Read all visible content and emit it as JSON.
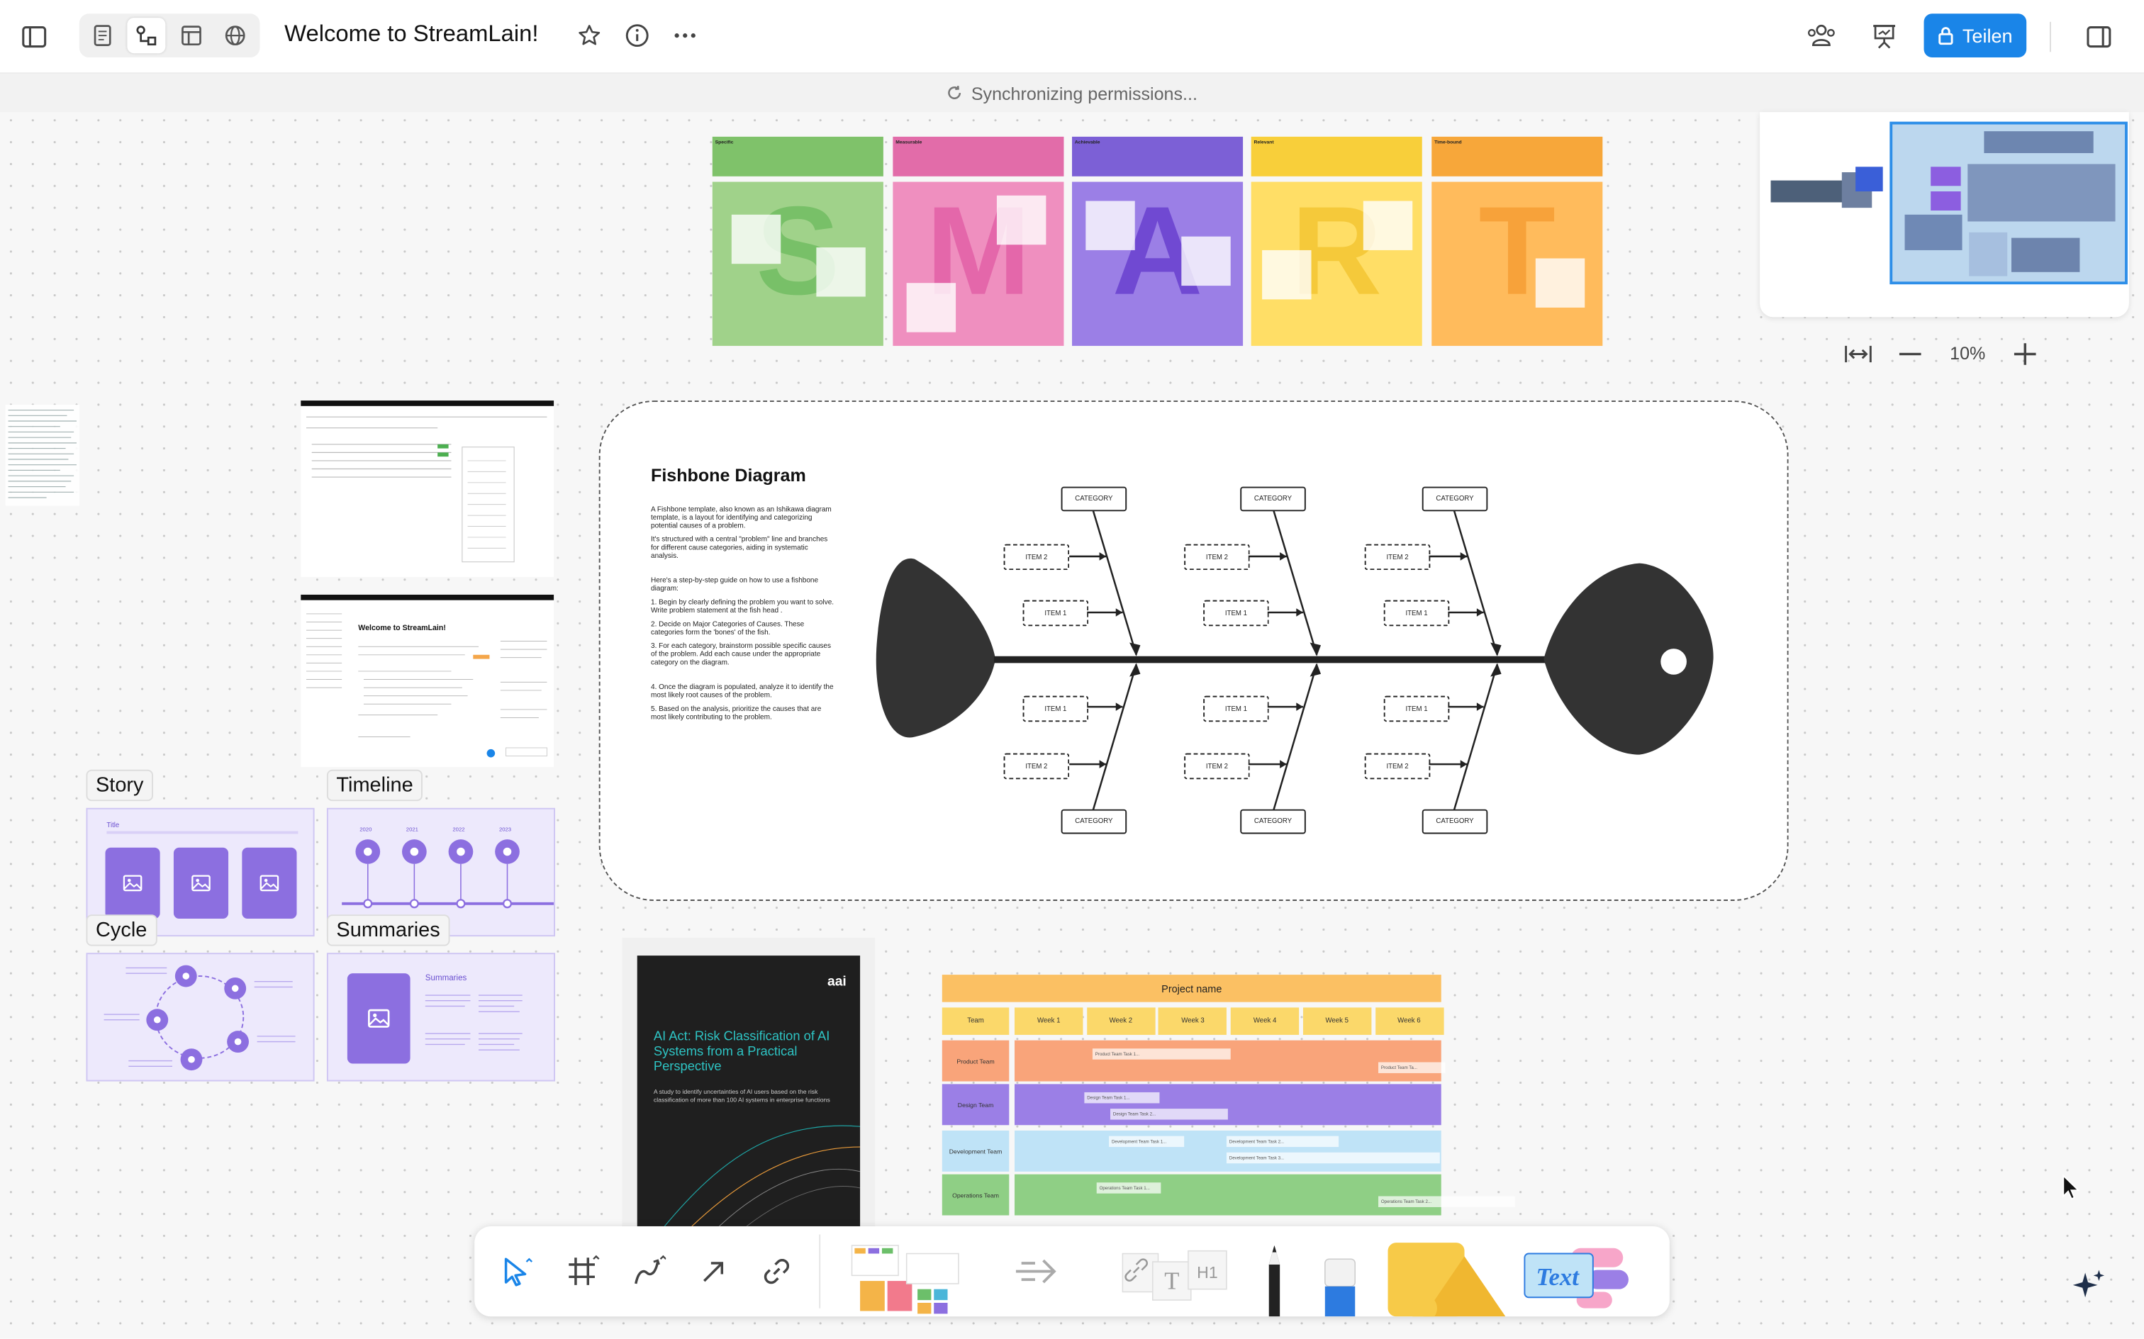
{
  "doc_title": "Welcome to StreamLain!",
  "share_label": "Teilen",
  "sync_text": "Synchronizing permissions...",
  "zoom_level": "10%",
  "labels": {
    "story": "Story",
    "timeline": "Timeline",
    "cycle": "Cycle",
    "summaries": "Summaries"
  },
  "smart": {
    "letters": [
      "S",
      "M",
      "A",
      "R",
      "T"
    ],
    "headers": [
      "Specific",
      "Measurable",
      "Achievable",
      "Relevant",
      "Time-bound"
    ],
    "colors": [
      "#a0d28a",
      "#ef8fbf",
      "#9b7fe6",
      "#ffde66",
      "#ffbb5c"
    ],
    "head_colors": [
      "#7fc26a",
      "#e26ca9",
      "#7c60d6",
      "#f8cf3a",
      "#f7a73a"
    ],
    "letter_colors": [
      "#78c068",
      "#e467aa",
      "#7049d2",
      "#f5c93a",
      "#f7a23a"
    ]
  },
  "fishbone": {
    "title": "Fishbone Diagram",
    "paragraphs": [
      "A Fishbone template, also known as an Ishikawa diagram template, is a layout for identifying and categorizing potential causes of a problem.",
      "It's structured with a central \"problem\" line and branches for different cause categories, aiding in systematic analysis.",
      "Here's a step-by-step guide on how to use a fishbone diagram:",
      "1. Begin by clearly defining the problem you want to solve. Write problem statement at the fish head .",
      "2. Decide on Major Categories of Causes. These categories form the 'bones' of the fish.",
      "3. For each category, brainstorm possible specific causes of the problem. Add each cause under the appropriate category on the diagram.",
      "4. Once the diagram is populated, analyze it to identify the most likely root causes of the problem.",
      "5. Based on the analysis, prioritize the causes that are most likely contributing to the problem."
    ],
    "category_label": "CATEGORY",
    "item1_label": "ITEM 1",
    "item2_label": "ITEM 2"
  },
  "story": {
    "title": "Title"
  },
  "timeline": {
    "years": [
      "2020",
      "2021",
      "2022",
      "2023"
    ]
  },
  "summaries": {
    "title": "Summaries"
  },
  "doc_preview": {
    "title": "Welcome to StreamLain!"
  },
  "ai_doc": {
    "logo": "aai",
    "title": "AI Act: Risk Classification of AI Systems from a Practical Perspective",
    "subtitle": "A study to identify uncertainties of AI users based on the risk classification of more than 100 AI systems in enterprise functions"
  },
  "gantt": {
    "title": "Project name",
    "team_header": "Team",
    "weeks": [
      "Week 1",
      "Week 2",
      "Week 3",
      "Week 4",
      "Week 5",
      "Week 6"
    ],
    "teams": [
      "Product Team",
      "Design Team",
      "Development Team",
      "Operations Team"
    ],
    "row_colors": [
      "#f9a47a",
      "#9b7fe6",
      "#bfe3f7",
      "#8fcf85"
    ],
    "tasks": [
      "Product Team Task 1...",
      "Product Team Ta...",
      "Design Team Task 1...",
      "Design Team Task 2...",
      "Development Team Task 1...",
      "Development Team Task 2...",
      "Development Team Task 3...",
      "Operations Team Task 1...",
      "Operations Team Task 2..."
    ]
  }
}
